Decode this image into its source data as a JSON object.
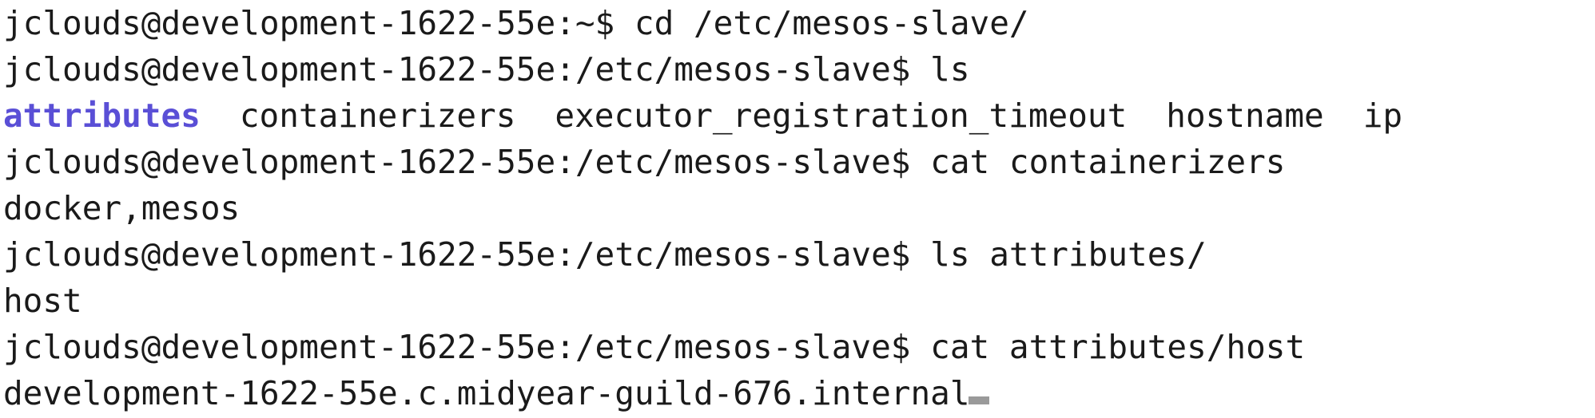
{
  "terminal": {
    "prompt": "jclouds@development-1622-55e:",
    "lines": [
      {
        "cwd": "~",
        "sym": "$ ",
        "cmd": "cd /etc/mesos-slave/"
      },
      {
        "cwd": "/etc/mesos-slave",
        "sym": "$ ",
        "cmd": "ls"
      },
      {
        "ls_items": [
          "attributes",
          "containerizers",
          "executor_registration_timeout",
          "hostname",
          "ip"
        ]
      },
      {
        "cwd": "/etc/mesos-slave",
        "sym": "$ ",
        "cmd": "cat containerizers"
      },
      {
        "output": "docker,mesos"
      },
      {
        "cwd": "/etc/mesos-slave",
        "sym": "$ ",
        "cmd": "ls attributes/"
      },
      {
        "output": "host"
      },
      {
        "cwd": "/etc/mesos-slave",
        "sym": "$ ",
        "cmd": "cat attributes/host"
      },
      {
        "output": "development-1622-55e.c.midyear-guild-676.internal"
      }
    ],
    "colors": {
      "background": "#ffffff",
      "text": "#1a1a1a",
      "directory": "#5a4fd6",
      "cursor": "#9a9a9a"
    }
  }
}
